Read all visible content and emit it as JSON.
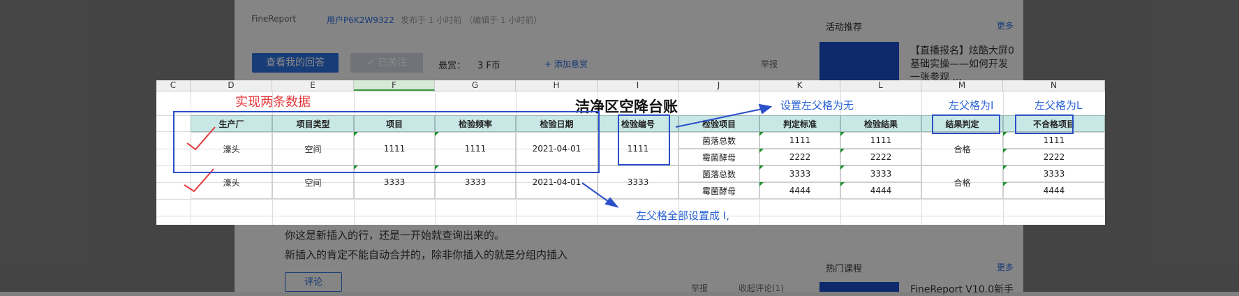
{
  "background_page": {
    "breadcrumb": {
      "site": "FineReport",
      "user": "用户P6K2W9322",
      "meta": "发布于 1 小时前 （编辑于 1 小时前）"
    },
    "buttons": {
      "my_answer": "查看我的回答",
      "followed": "✓ 已关注",
      "add_reward": "+ 添加悬赏",
      "report": "举报"
    },
    "reward": {
      "label": "悬赏：",
      "value": "3 F币"
    },
    "sidebar": {
      "activity_title": "活动推荐",
      "more": "更多",
      "activity_text": [
        "【直播报名】炫酷大屏0",
        "基础实操——如何开发",
        "一张参观 ..."
      ],
      "hot_title": "热门课程",
      "hot_course": "FineReport V10.0新手"
    },
    "comments": {
      "line1": "你这是新插入的行，还是一开始就查询出来的。",
      "line2": "新插入的肯定不能自动合并的，除非你插入的就是分组内插入",
      "comment_btn": "评论",
      "report": "举报",
      "collapse": "收起评论(1)"
    }
  },
  "sheet": {
    "columns": [
      "C",
      "D",
      "E",
      "F",
      "G",
      "H",
      "I",
      "J",
      "K",
      "L",
      "M",
      "N"
    ],
    "selected_column": "F",
    "title": "洁净区空降台账",
    "headers": [
      "生产厂",
      "项目类型",
      "项目",
      "检验频率",
      "检验日期",
      "检验编号",
      "检验项目",
      "判定标准",
      "检验结果",
      "结果判定",
      "不合格项目"
    ],
    "records": [
      {
        "factory": "濠头",
        "type": "空间",
        "item": "1111",
        "freq": "1111",
        "date": "2021-04-01",
        "no": "1111",
        "judge": "合格",
        "subrows": [
          {
            "check": "菌落总数",
            "std": "1111",
            "result": "1111",
            "bad": "1111"
          },
          {
            "check": "霉菌酵母",
            "std": "2222",
            "result": "2222",
            "bad": "2222"
          }
        ]
      },
      {
        "factory": "濠头",
        "type": "空间",
        "item": "3333",
        "freq": "3333",
        "date": "2021-04-01",
        "no": "3333",
        "judge": "合格",
        "subrows": [
          {
            "check": "菌落总数",
            "std": "3333",
            "result": "3333",
            "bad": "3333"
          },
          {
            "check": "霉菌酵母",
            "std": "4444",
            "result": "4444",
            "bad": "4444"
          }
        ]
      }
    ]
  },
  "annotations": {
    "red_note": "实现两条数据",
    "note_parent_none": "设置左父格为无",
    "note_m": "左父格为I",
    "note_n": "左父格为L",
    "note_all": "左父格全部设置成 I,"
  },
  "colors": {
    "annotation_blue": "#2a62d6",
    "annotation_red": "#e2393c",
    "header_fill": "#c8e8e6",
    "dim_overlay": "#7f7f7f"
  }
}
